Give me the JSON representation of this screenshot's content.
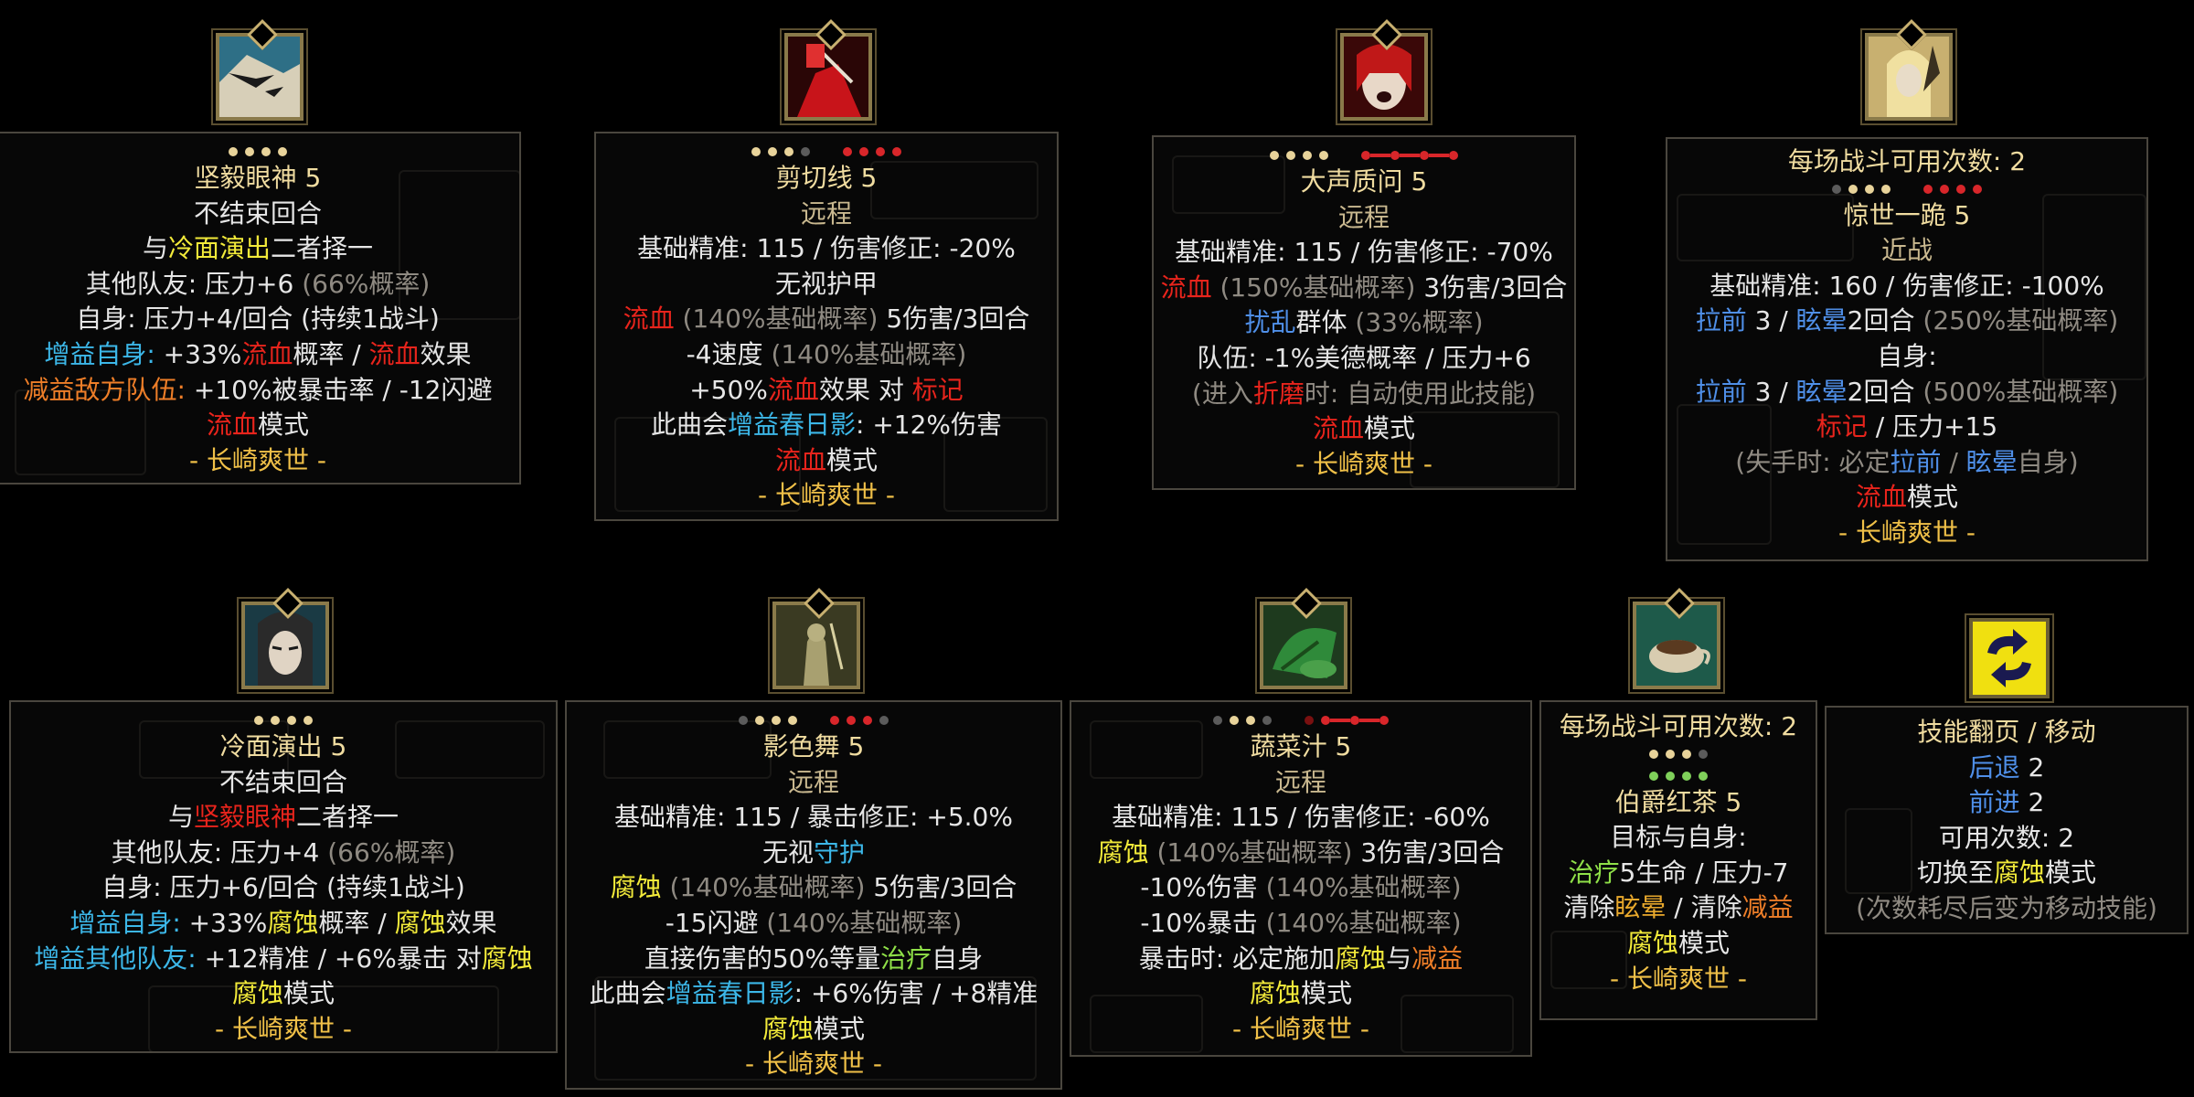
{
  "skills": {
    "s1": {
      "name": "坚毅眼神 5",
      "l1": "不结束回合",
      "l2a": "与",
      "l2b": "冷面演出",
      "l2c": "二者择一",
      "l3a": "其他队友: 压力+6",
      "l3b": " (66%概率)",
      "l4": "自身: 压力+4/回合 (持续1战斗)",
      "l5a": "增益自身: ",
      "l5b": "+33%",
      "l5c": "流血",
      "l5d": "概率 / ",
      "l5e": "流血",
      "l5f": "效果",
      "l6a": "减益敌方队伍: ",
      "l6b": "+10%被暴击率 / -12闪避",
      "l7a": "流血",
      "l7b": "模式",
      "sig": "- 长崎爽世 -"
    },
    "s2": {
      "name": "剪切线 5",
      "type": "远程",
      "l1": "基础精准: 115 / 伤害修正: -20%",
      "l2": "无视护甲",
      "l3a": "流血",
      "l3b": " (140%基础概率) ",
      "l3c": "5伤害/3回合",
      "l4a": "-4速度",
      "l4b": " (140%基础概率)",
      "l5a": "+50%",
      "l5b": "流血",
      "l5c": "效果 对 ",
      "l5d": "标记",
      "l6a": "此曲会",
      "l6b": "增益春日影",
      "l6c": ": +12%伤害",
      "l7a": "流血",
      "l7b": "模式",
      "sig": "- 长崎爽世 -"
    },
    "s3": {
      "name": "大声质问 5",
      "type": "远程",
      "l1": "基础精准: 115 / 伤害修正: -70%",
      "l2a": "流血",
      "l2b": " (150%基础概率) ",
      "l2c": "3伤害/3回合",
      "l3a": "扰乱",
      "l3b": "群体",
      "l3c": " (33%概率)",
      "l4": "队伍: -1%美德概率 / 压力+6",
      "l5a": "(进入",
      "l5b": "折磨",
      "l5c": "时: 自动使用此技能)",
      "l6a": "流血",
      "l6b": "模式",
      "sig": "- 长崎爽世 -"
    },
    "s4": {
      "uses": "每场战斗可用次数: 2",
      "name": "惊世一跪 5",
      "type": "近战",
      "l1": "基础精准: 160 / 伤害修正: -100%",
      "l2a": "拉前",
      "l2b": " 3 / ",
      "l2c": "眩晕",
      "l2d": "2回合",
      "l2e": " (250%基础概率)",
      "l3": "自身:",
      "l4a": "拉前",
      "l4b": " 3 / ",
      "l4c": "眩晕",
      "l4d": "2回合",
      "l4e": " (500%基础概率)",
      "l5a": "标记",
      "l5b": " / 压力+15",
      "l6a": "(失手时: 必定",
      "l6b": "拉前",
      "l6c": " / ",
      "l6d": "眩晕",
      "l6e": "自身)",
      "l7a": "流血",
      "l7b": "模式",
      "sig": "- 长崎爽世 -"
    },
    "s5": {
      "name": "冷面演出 5",
      "l1": "不结束回合",
      "l2a": "与",
      "l2b": "坚毅眼神",
      "l2c": "二者择一",
      "l3a": "其他队友: 压力+4",
      "l3b": " (66%概率)",
      "l4": "自身: 压力+6/回合 (持续1战斗)",
      "l5a": "增益自身: ",
      "l5b": "+33%",
      "l5c": "腐蚀",
      "l5d": "概率 / ",
      "l5e": "腐蚀",
      "l5f": "效果",
      "l6a": "增益其他队友: ",
      "l6b": "+12精准 / +6%暴击 对",
      "l6c": "腐蚀",
      "l7a": "腐蚀",
      "l7b": "模式",
      "sig": "- 长崎爽世 -"
    },
    "s6": {
      "name": "影色舞 5",
      "type": "远程",
      "l1": "基础精准: 115 / 暴击修正: +5.0%",
      "l2a": "无视",
      "l2b": "守护",
      "l3a": "腐蚀",
      "l3b": " (140%基础概率) ",
      "l3c": "5伤害/3回合",
      "l4a": "-15闪避",
      "l4b": " (140%基础概率)",
      "l5a": "直接伤害的50%等量",
      "l5b": "治疗",
      "l5c": "自身",
      "l6a": "此曲会",
      "l6b": "增益春日影",
      "l6c": ": +6%伤害 / +8精准",
      "l7a": "腐蚀",
      "l7b": "模式",
      "sig": "- 长崎爽世 -"
    },
    "s7": {
      "name": "蔬菜汁 5",
      "type": "远程",
      "l1": "基础精准: 115 / 伤害修正: -60%",
      "l2a": "腐蚀",
      "l2b": " (140%基础概率) ",
      "l2c": "3伤害/3回合",
      "l3a": "-10%伤害",
      "l3b": " (140%基础概率)",
      "l4a": "-10%暴击",
      "l4b": " (140%基础概率)",
      "l5a": "暴击时: 必定施加",
      "l5b": "腐蚀",
      "l5c": "与",
      "l5d": "减益",
      "l6a": "腐蚀",
      "l6b": "模式",
      "sig": "- 长崎爽世 -"
    },
    "s8": {
      "uses": "每场战斗可用次数: 2",
      "name": "伯爵红茶 5",
      "l1": "目标与自身:",
      "l2a": "治疗",
      "l2b": "5生命 / 压力-7",
      "l3a": "清除",
      "l3b": "眩晕",
      "l3c": " / 清除",
      "l3d": "减益",
      "l4a": "腐蚀",
      "l4b": "模式",
      "sig": "- 长崎爽世 -"
    },
    "s9": {
      "name": "技能翻页 / 移动",
      "l1a": "后退",
      "l1b": " 2",
      "l2a": "前进",
      "l2b": " 2",
      "l3": "可用次数: 2",
      "l4a": "切换至",
      "l4b": "腐蚀",
      "l4c": "模式",
      "l5": "(次数耗尽后变为移动技能)"
    }
  },
  "icons": {
    "s1": "stern-gaze-portrait-icon",
    "s2": "cut-line-portrait-icon",
    "s3": "loud-question-portrait-icon",
    "s4": "kneel-portrait-icon",
    "s5": "cold-performance-portrait-icon",
    "s6": "shadow-dance-portrait-icon",
    "s7": "vegetable-juice-icon",
    "s8": "earl-grey-tea-icon",
    "s9": "swap-arrows-icon"
  },
  "colors": {
    "bleed": "#e8241c",
    "blight": "#f2ea3a",
    "buff": "#3cb7e8",
    "debuff": "#ee7e28",
    "heal": "#8fe048",
    "move": "#4f8fe8",
    "title": "#f0dca0",
    "signature": "#f0c048"
  }
}
